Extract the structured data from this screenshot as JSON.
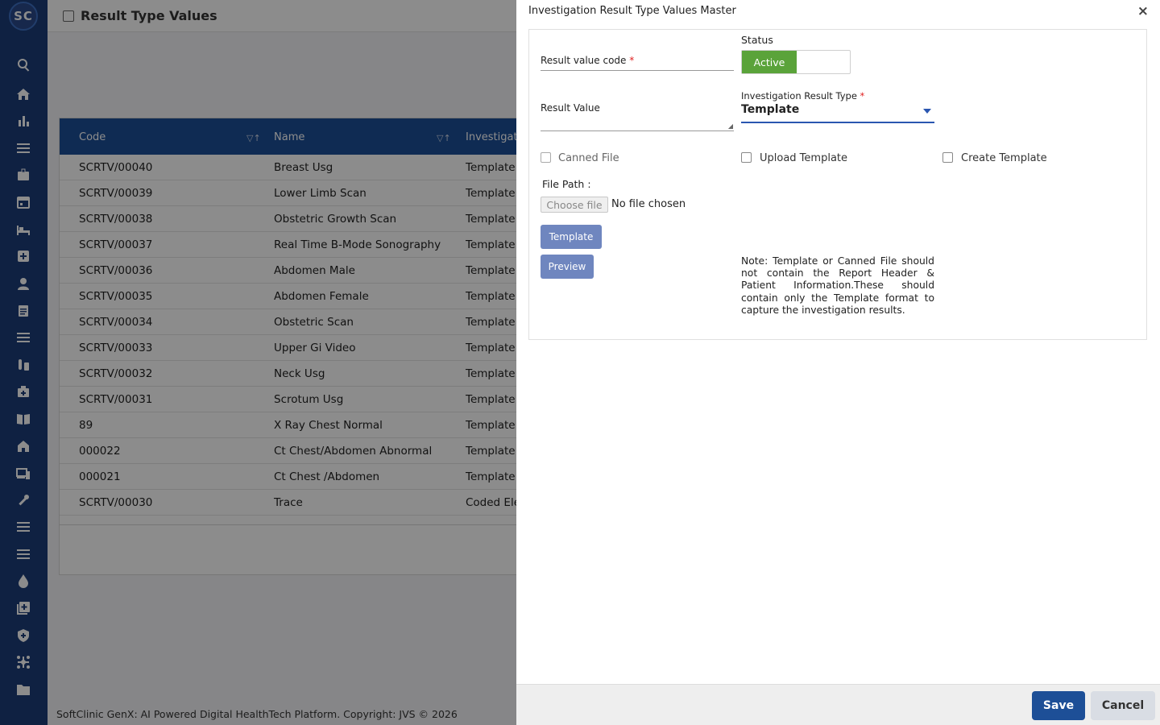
{
  "app": {
    "logo_text": "SC",
    "page_title": "Result Type Values",
    "footer": "SoftClinic GenX: AI Powered Digital HealthTech Platform. Copyright: JVS © 2026"
  },
  "sidebar": {
    "icons": [
      "search-icon",
      "home-icon",
      "bar-chart-icon",
      "menu-icon",
      "badge-icon",
      "calendar-icon",
      "bed-icon",
      "plus-box-icon",
      "user-icon",
      "document-icon",
      "list-icon",
      "lab-icon",
      "medical-bag-icon",
      "book-icon",
      "building-icon",
      "devices-icon",
      "wrench-icon",
      "list-icon-2",
      "list-icon-3",
      "drop-icon",
      "add-box-icon",
      "shield-icon",
      "network-icon",
      "folder-icon"
    ]
  },
  "grid": {
    "columns": [
      "Code",
      "Name",
      "Investigatio"
    ],
    "rows": [
      {
        "code": "SCRTV/00040",
        "name": "Breast Usg",
        "type": "Template"
      },
      {
        "code": "SCRTV/00039",
        "name": "Lower Limb Scan",
        "type": "Template"
      },
      {
        "code": "SCRTV/00038",
        "name": "Obstetric Growth Scan",
        "type": "Template"
      },
      {
        "code": "SCRTV/00037",
        "name": "Real Time B-Mode Sonography",
        "type": "Template"
      },
      {
        "code": "SCRTV/00036",
        "name": "Abdomen Male",
        "type": "Template"
      },
      {
        "code": "SCRTV/00035",
        "name": "Abdomen Female",
        "type": "Template"
      },
      {
        "code": "SCRTV/00034",
        "name": "Obstetric Scan",
        "type": "Template"
      },
      {
        "code": "SCRTV/00033",
        "name": "Upper Gi Video",
        "type": "Template"
      },
      {
        "code": "SCRTV/00032",
        "name": "Neck Usg",
        "type": "Template"
      },
      {
        "code": "SCRTV/00031",
        "name": "Scrotum Usg",
        "type": "Template"
      },
      {
        "code": "89",
        "name": "X Ray Chest Normal",
        "type": "Template"
      },
      {
        "code": "000022",
        "name": "Ct Chest/Abdomen Abnormal",
        "type": "Template"
      },
      {
        "code": "000021",
        "name": "Ct Chest /Abdomen",
        "type": "Template"
      },
      {
        "code": "SCRTV/00030",
        "name": "Trace",
        "type": "Coded Ele"
      }
    ]
  },
  "panel": {
    "title": "Investigation Result Type Values Master",
    "close_label": "×",
    "result_value_code_label": "Result value code",
    "required_mark": "*",
    "status_label": "Status",
    "status_active": "Active",
    "result_value_label": "Result Value",
    "result_type_label": "Investigation Result Type",
    "result_type_value": "Template",
    "canned_file_label": "Canned File",
    "upload_template_label": "Upload Template",
    "create_template_label": "Create Template",
    "file_path_label": "File Path :",
    "choose_file_label": "Choose file",
    "no_file_label": "No file chosen",
    "template_button": "Template",
    "preview_button": "Preview",
    "note": "Note: Template or Canned File should not contain the Report Header & Patient Information.These should contain only the Template format to capture the investigation results.",
    "save_button": "Save",
    "cancel_button": "Cancel"
  },
  "colors": {
    "sidebar": "#1d3d78",
    "grid_header": "#1d4f97",
    "active_green": "#5aa33a",
    "save_blue": "#1d4f97"
  }
}
